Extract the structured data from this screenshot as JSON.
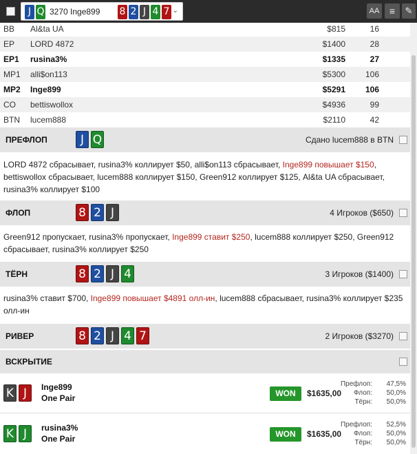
{
  "header": {
    "hand_label": "3270 Inge899",
    "hole_cards": [
      "J",
      "Q"
    ],
    "board_cards": [
      "8",
      "2",
      "J",
      "4",
      "7"
    ],
    "buttons": [
      "AA",
      "≡",
      "✎"
    ]
  },
  "seats": [
    {
      "pos": "BB",
      "name": "Al&ta UA",
      "stack": "$815",
      "bb": "16",
      "bold": false
    },
    {
      "pos": "EP",
      "name": "LORD 4872",
      "stack": "$1400",
      "bb": "28",
      "bold": false
    },
    {
      "pos": "EP1",
      "name": "rusina3%",
      "stack": "$1335",
      "bb": "27",
      "bold": true
    },
    {
      "pos": "MP1",
      "name": "alli$on113",
      "stack": "$5300",
      "bb": "106",
      "bold": false
    },
    {
      "pos": "MP2",
      "name": "Inge899",
      "stack": "$5291",
      "bb": "106",
      "bold": true
    },
    {
      "pos": "CO",
      "name": "bettiswollox",
      "stack": "$4936",
      "bb": "99",
      "bold": false
    },
    {
      "pos": "BTN",
      "name": "lucem888",
      "stack": "$2110",
      "bb": "42",
      "bold": false
    }
  ],
  "preflop": {
    "title": "ПРЕФЛОП",
    "right": "Сдано lucem888 в BTN",
    "cards": [
      "J",
      "Q"
    ],
    "actions": [
      {
        "t": "LORD 4872 сбрасывает, rusina3% коллирует $50, alli$on113 сбрасывает, ",
        "red": false
      },
      {
        "t": "Inge899 повышает $150",
        "red": true
      },
      {
        "t": ", bettiswollox сбрасывает, lucem888 коллирует $150, Green912 коллирует $125, Al&ta UA сбрасывает, rusina3% коллирует $100",
        "red": false
      }
    ]
  },
  "flop": {
    "title": "ФЛОП",
    "right": "4 Игроков ($650)",
    "cards": [
      "8",
      "2",
      "J"
    ],
    "actions": [
      {
        "t": "Green912 пропускает, rusina3% пропускает, ",
        "red": false
      },
      {
        "t": "Inge899 ставит $250",
        "red": true
      },
      {
        "t": ", lucem888 коллирует $250, Green912 сбрасывает, rusina3% коллирует $250",
        "red": false
      }
    ]
  },
  "turn": {
    "title": "ТЁРН",
    "right": "3 Игроков ($1400)",
    "cards": [
      "8",
      "2",
      "J",
      "4"
    ],
    "actions": [
      {
        "t": "rusina3% ставит $700, ",
        "red": false
      },
      {
        "t": "Inge899 повышает $4891 олл-ин",
        "red": true
      },
      {
        "t": ", lucem888 сбрасывает, rusina3% коллирует $235 олл-ин",
        "red": false
      }
    ]
  },
  "river": {
    "title": "РИВЕР",
    "right": "2 Игроков ($3270)",
    "cards": [
      "8",
      "2",
      "J",
      "4",
      "7"
    ]
  },
  "showdown": {
    "title": "ВСКРЫТИЕ",
    "players": [
      {
        "name": "Inge899",
        "hand": "One Pair",
        "cards": [
          "K",
          "J"
        ],
        "won_label": "WON",
        "amount": "$1635,00",
        "stats": [
          {
            "l": "Префлоп:",
            "v": "47,5%"
          },
          {
            "l": "Флоп:",
            "v": "50,0%"
          },
          {
            "l": "Тёрн:",
            "v": "50,0%"
          }
        ]
      },
      {
        "name": "rusina3%",
        "hand": "One Pair",
        "cards": [
          "K",
          "J"
        ],
        "won_label": "WON",
        "amount": "$1635,00",
        "stats": [
          {
            "l": "Префлоп:",
            "v": "52,5%"
          },
          {
            "l": "Флоп:",
            "v": "50,0%"
          },
          {
            "l": "Тёрн:",
            "v": "50,0%"
          }
        ]
      }
    ]
  },
  "colors": {
    "won": "#25962a",
    "raise_text": "#b3261e",
    "card_blue": "#1f4fa0",
    "card_green": "#1f8a2e",
    "card_red": "#b01414",
    "card_gray": "#444444"
  }
}
